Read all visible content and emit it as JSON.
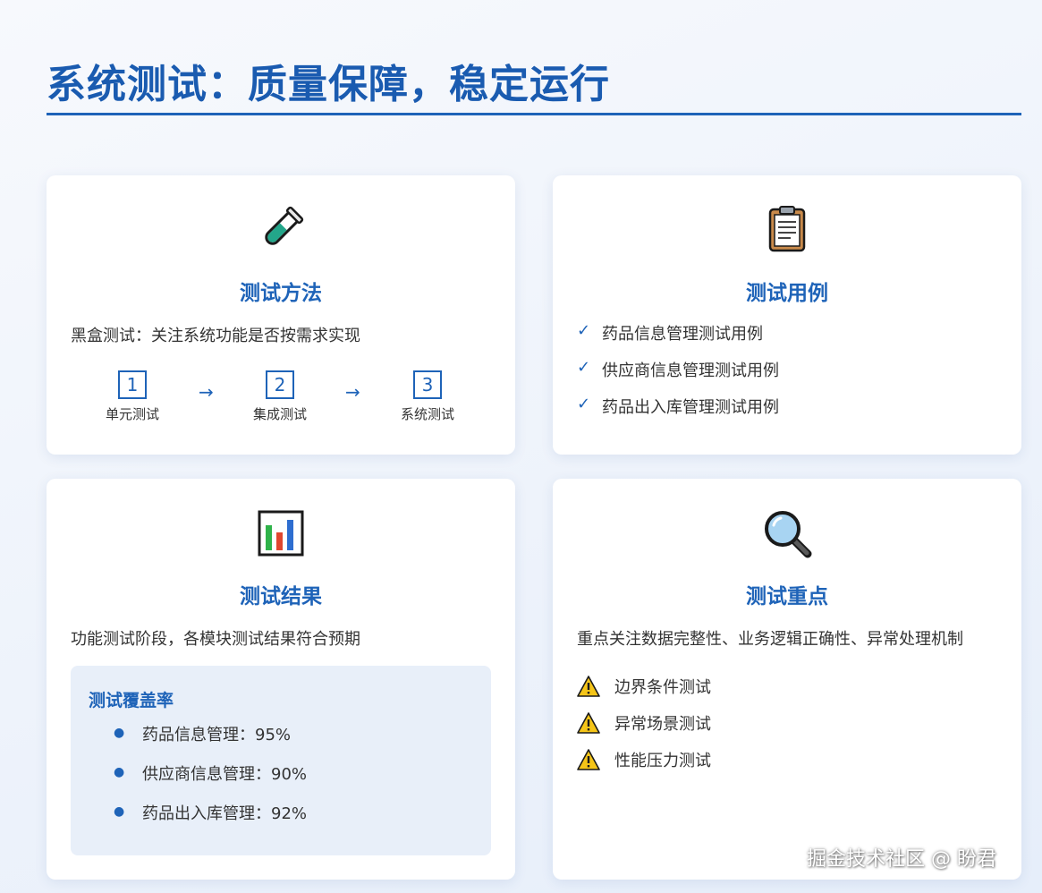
{
  "title": "系统测试：质量保障，稳定运行",
  "colors": {
    "accent": "#1e63b8",
    "card_bg": "#ffffff",
    "coverage_bg": "#e8eff9"
  },
  "cards": {
    "method": {
      "icon": "test-tube-icon",
      "title": "测试方法",
      "desc": "黑盒测试：关注系统功能是否按需求实现",
      "steps": [
        {
          "num": "1",
          "label": "单元测试"
        },
        {
          "num": "2",
          "label": "集成测试"
        },
        {
          "num": "3",
          "label": "系统测试"
        }
      ],
      "arrow": "→"
    },
    "cases": {
      "icon": "clipboard-icon",
      "title": "测试用例",
      "check": "✓",
      "items": [
        "药品信息管理测试用例",
        "供应商信息管理测试用例",
        "药品出入库管理测试用例"
      ]
    },
    "results": {
      "icon": "bar-chart-icon",
      "title": "测试结果",
      "desc": "功能测试阶段，各模块测试结果符合预期",
      "coverage_title": "测试覆盖率",
      "bullet": "●",
      "coverage_items": [
        "药品信息管理：95%",
        "供应商信息管理：90%",
        "药品出入库管理：92%"
      ]
    },
    "focus": {
      "icon": "magnifier-icon",
      "title": "测试重点",
      "desc": "重点关注数据完整性、业务逻辑正确性、异常处理机制",
      "items": [
        "边界条件测试",
        "异常场景测试",
        "性能压力测试"
      ]
    }
  },
  "watermark": "掘金技术社区 @ 盼君"
}
